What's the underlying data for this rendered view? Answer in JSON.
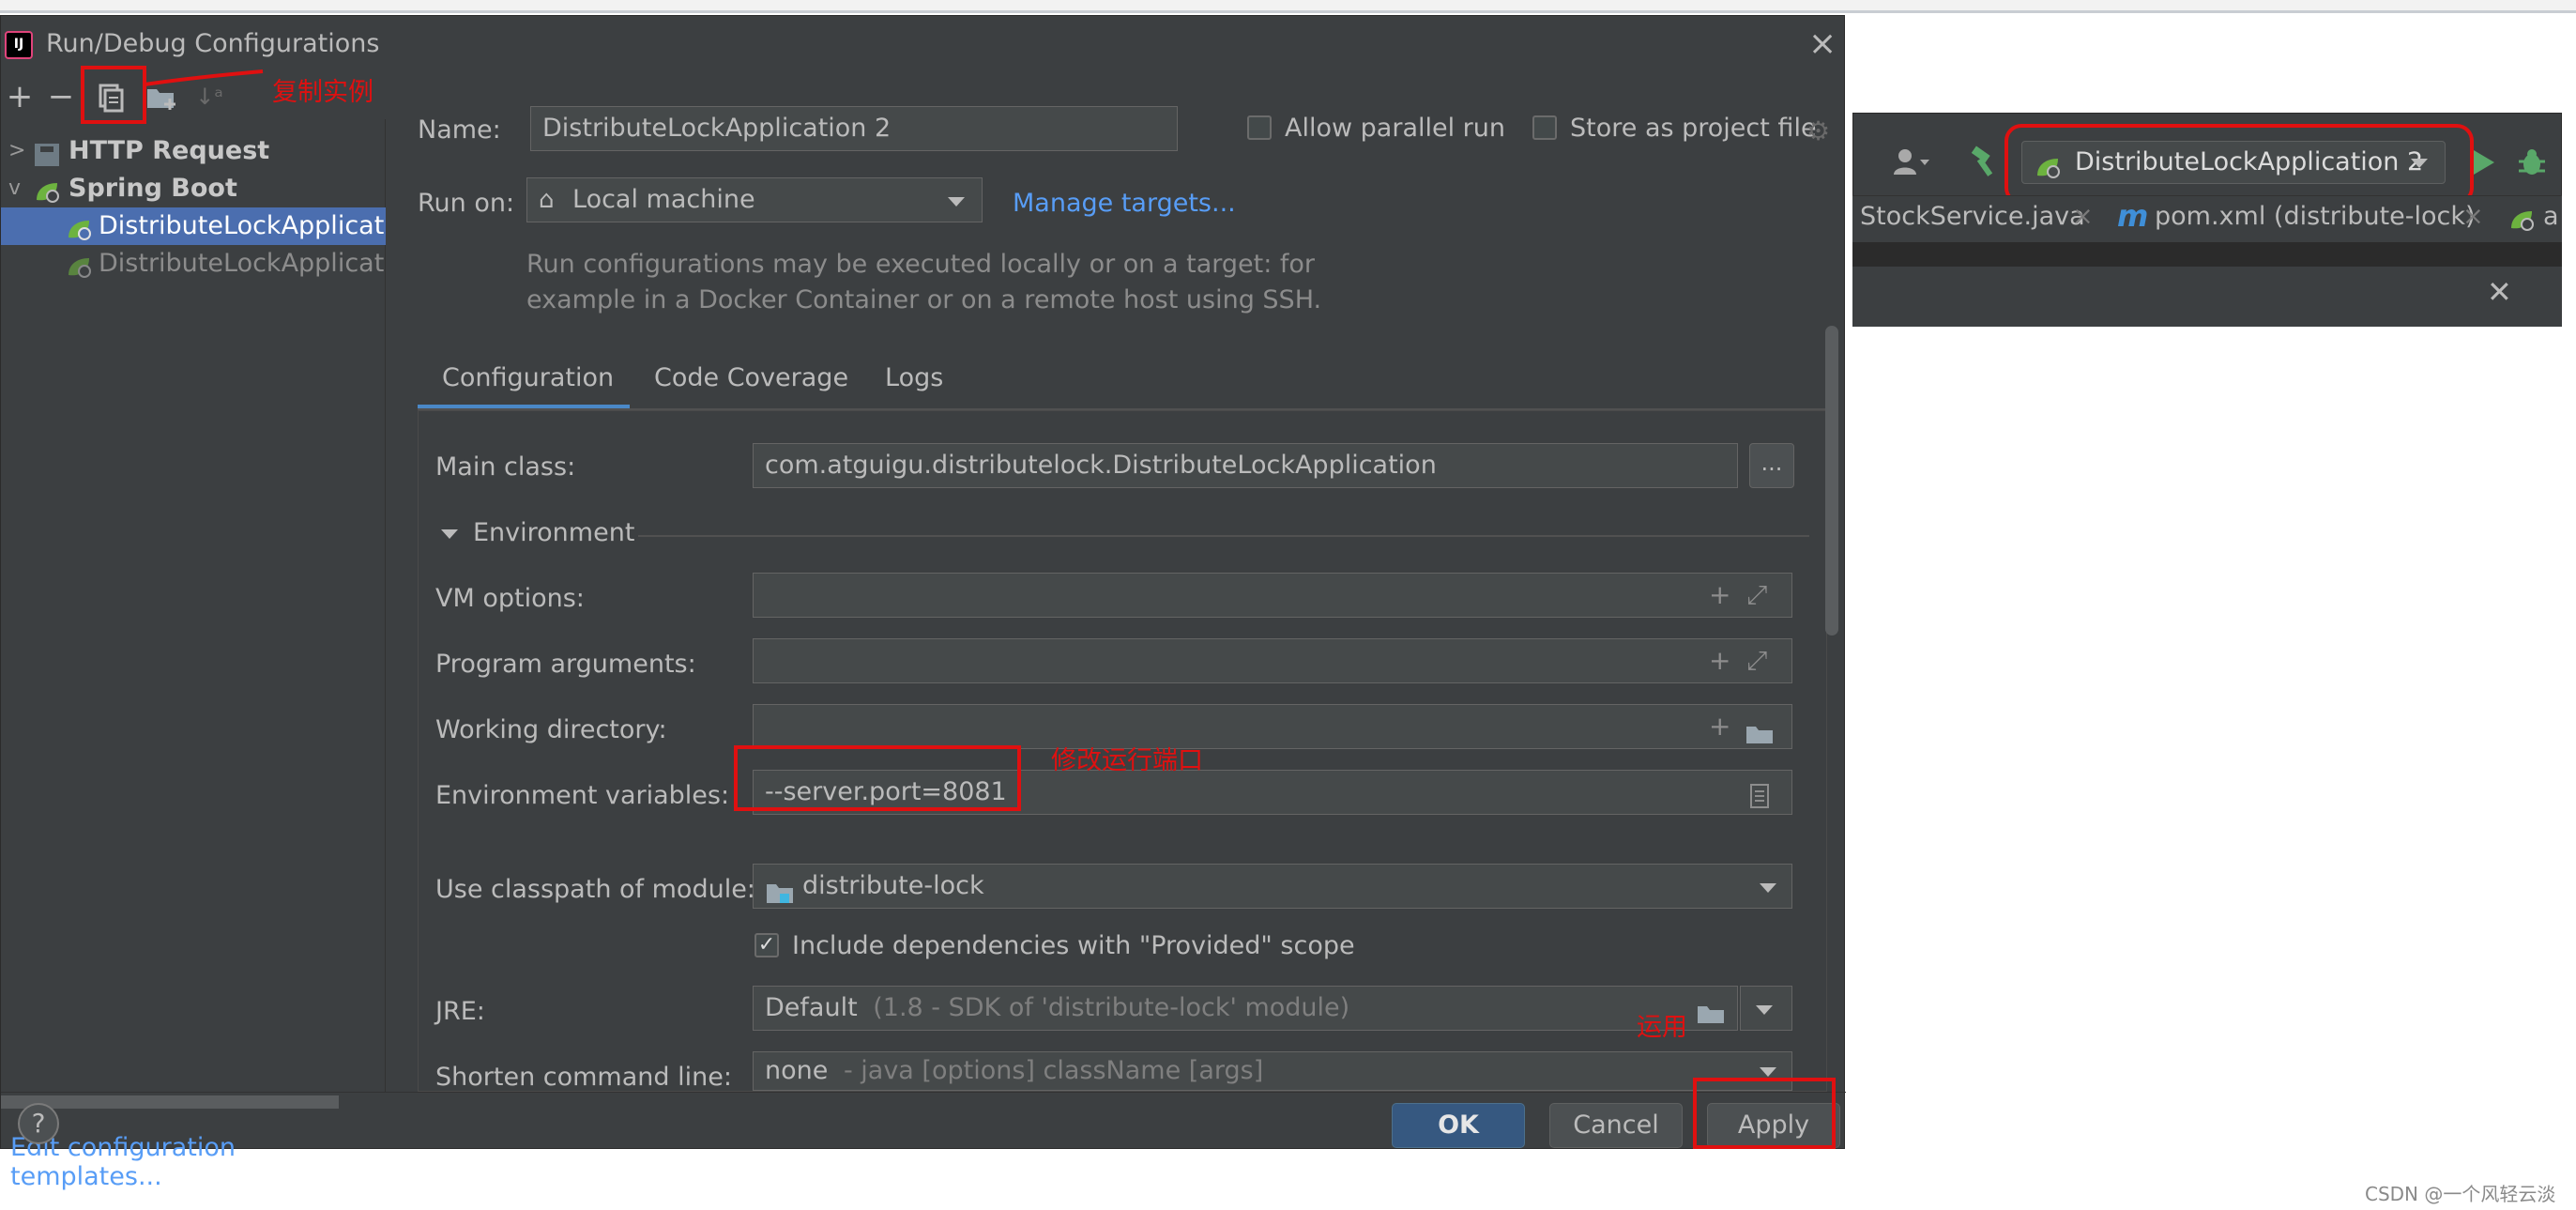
{
  "dialog": {
    "title": "Run/Debug Configurations",
    "app_icon_text": "IJ",
    "close_glyph": "×"
  },
  "toolbar": {
    "add_glyph": "+",
    "remove_glyph": "−",
    "copy_icon": "copy-icon",
    "folder_icon": "new-folder-icon",
    "sort_icon": "sort-icon",
    "sort_glyph": "↓ᵃ"
  },
  "tree": {
    "items": [
      {
        "label": "HTTP Request",
        "icon": "api-icon",
        "icon_text": "API",
        "expanded": false
      },
      {
        "label": "Spring Boot",
        "icon": "spring-boot-icon",
        "expanded": true
      },
      {
        "label": "DistributeLockApplicatio",
        "icon": "spring-boot-icon",
        "selected": true
      },
      {
        "label": "DistributeLockApplicatio",
        "icon": "spring-boot-icon",
        "selected": false
      }
    ],
    "edit_templates": "Edit configuration templates..."
  },
  "form": {
    "name_label": "Name:",
    "name_value": "DistributeLockApplication 2",
    "allow_parallel": "Allow parallel run",
    "store_project": "Store as project file",
    "run_on_label": "Run on:",
    "run_on_value": "Local machine",
    "manage_targets": "Manage targets...",
    "note_line1": "Run configurations may be executed locally or on a target: for",
    "note_line2": "example in a Docker Container or on a remote host using SSH.",
    "tabs": [
      "Configuration",
      "Code Coverage",
      "Logs"
    ],
    "active_tab": "Configuration",
    "main_class_label": "Main class:",
    "main_class_value": "com.atguigu.distributelock.DistributeLockApplication",
    "ellipsis": "...",
    "environment_label": "Environment",
    "vm_options_label": "VM options:",
    "program_args_label": "Program arguments:",
    "working_dir_label": "Working directory:",
    "env_vars_label": "Environment variables:",
    "env_vars_value": "--server.port=8081",
    "classpath_label": "Use classpath of module:",
    "classpath_value": "distribute-lock",
    "include_deps": "Include dependencies with \"Provided\" scope",
    "jre_label": "JRE:",
    "jre_value": "Default",
    "jre_hint": "(1.8 - SDK of 'distribute-lock' module)",
    "shorten_label": "Shorten command line:",
    "shorten_value": "none",
    "shorten_hint": "- java [options] className [args]",
    "plus_glyph": "+",
    "expand_glyph": "⤢"
  },
  "footer": {
    "help": "?",
    "ok": "OK",
    "cancel": "Cancel",
    "apply": "Apply"
  },
  "annotations": {
    "copy_instance": "复制实例",
    "modify_port": "修改运行端口",
    "apply_note": "运用"
  },
  "ide": {
    "run_config": "DistributeLockApplication 2",
    "tabs": [
      {
        "label": "StockService.java",
        "icon": ""
      },
      {
        "label": "pom.xml (distribute-lock)",
        "icon": "maven-icon",
        "icon_text": "m"
      },
      {
        "label": "a",
        "icon": "spring-boot-icon"
      }
    ],
    "tab_close": "×",
    "popup_close": "✕"
  },
  "watermark": "CSDN @一个风轻云淡",
  "colors": {
    "dialog_bg": "#3c3f41",
    "selection": "#4b6eaf",
    "link": "#589df6",
    "annotation_red": "#e01010",
    "ok_button": "#365880"
  }
}
